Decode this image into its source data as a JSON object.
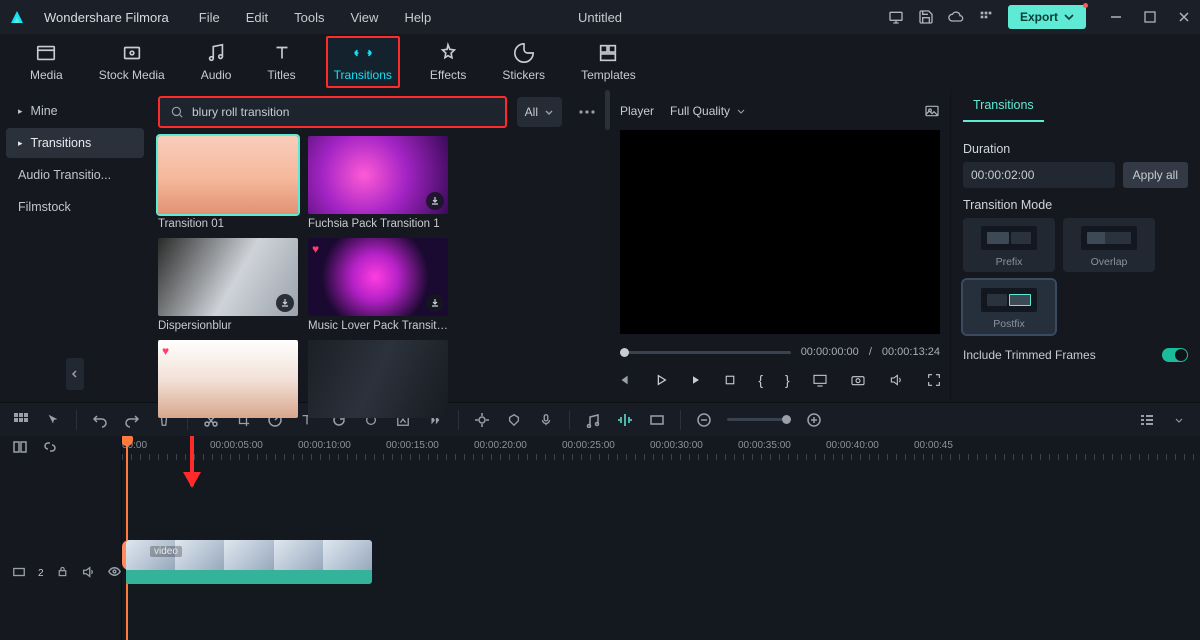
{
  "app": {
    "name": "Wondershare Filmora",
    "doc_title": "Untitled",
    "export": "Export"
  },
  "menu": [
    "File",
    "Edit",
    "Tools",
    "View",
    "Help"
  ],
  "top_tabs": [
    {
      "id": "media",
      "label": "Media"
    },
    {
      "id": "stock",
      "label": "Stock Media"
    },
    {
      "id": "audio",
      "label": "Audio"
    },
    {
      "id": "titles",
      "label": "Titles"
    },
    {
      "id": "transitions",
      "label": "Transitions"
    },
    {
      "id": "effects",
      "label": "Effects"
    },
    {
      "id": "stickers",
      "label": "Stickers"
    },
    {
      "id": "templates",
      "label": "Templates"
    }
  ],
  "active_top_tab": "transitions",
  "sidebar": {
    "items": [
      {
        "label": "Mine",
        "expandable": true
      },
      {
        "label": "Transitions",
        "expandable": true,
        "selected": true
      },
      {
        "label": "Audio Transitio..."
      },
      {
        "label": "Filmstock"
      }
    ]
  },
  "search": {
    "value": "blury roll transition",
    "filter": "All"
  },
  "thumbs": [
    {
      "label": "Transition 01",
      "cls": "t01",
      "selected": true
    },
    {
      "label": "Fuchsia Pack Transition 1",
      "cls": "t02",
      "dl": true
    },
    {
      "label": "Dispersionblur",
      "cls": "t03",
      "dl": true
    },
    {
      "label": "Music Lover Pack Transition ...",
      "cls": "t04",
      "dl": true,
      "heart": true
    },
    {
      "label": "",
      "cls": "t05",
      "heart": true
    },
    {
      "label": "",
      "cls": "t06"
    }
  ],
  "player": {
    "label": "Player",
    "quality": "Full Quality",
    "cur": "00:00:00:00",
    "total": "00:00:13:24"
  },
  "rightpanel": {
    "tab": "Transitions",
    "duration_label": "Duration",
    "duration_value": "00:00:02:00",
    "apply_all": "Apply all",
    "mode_label": "Transition Mode",
    "modes": [
      {
        "label": "Prefix"
      },
      {
        "label": "Overlap"
      },
      {
        "label": "Postfix",
        "selected": true
      }
    ],
    "trimmed_label": "Include Trimmed Frames"
  },
  "ruler": [
    "00:00",
    "00:00:05:00",
    "00:00:10:00",
    "00:00:15:00",
    "00:00:20:00",
    "00:00:25:00",
    "00:00:30:00",
    "00:00:35:00",
    "00:00:40:00",
    "00:00:45"
  ],
  "clip": {
    "label": "video"
  },
  "track_head": {
    "num": "2"
  }
}
